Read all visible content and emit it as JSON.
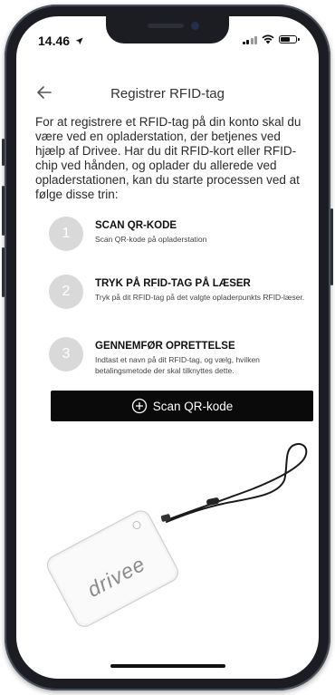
{
  "status_bar": {
    "time": "14.46",
    "location_icon": "location-arrow-icon",
    "signal_icon": "cellular-signal-icon",
    "wifi_icon": "wifi-icon",
    "battery_icon": "battery-icon"
  },
  "header": {
    "back_icon": "arrow-left-icon",
    "title": "Registrer RFID-tag"
  },
  "intro": "For at registrere et RFID-tag på din konto skal du være ved en opladerstation, der betjenes ved hjælp af Drivee. Har du dit RFID-kort eller RFID-chip ved hånden, og oplader du allerede ved opladerstationen, kan du starte processen ved at følge disse trin:",
  "steps": [
    {
      "number": "1",
      "title": "SCAN QR-KODE",
      "description": "Scan QR-kode på opladerstation"
    },
    {
      "number": "2",
      "title": "TRYK PÅ RFID-TAG PÅ LÆSER",
      "description": "Tryk på dit RFID-tag på det valgte opladerpunkts RFID-læser."
    },
    {
      "number": "3",
      "title": "GENNEMFØR OPRETTELSE",
      "description": "Indtast et navn på dit RFID-tag, og vælg, hvilken betalingsmetode der skal tilknyttes dette."
    }
  ],
  "scan_button": {
    "icon": "plus-circle-icon",
    "label": "Scan QR-kode"
  },
  "illustration": {
    "brand": "drivee",
    "description_icon": "rfid-keyfob-image"
  },
  "colors": {
    "button_bg": "#0a0a0a",
    "step_circle": "#d9d9d9",
    "phone_frame": "#1b1d22"
  }
}
